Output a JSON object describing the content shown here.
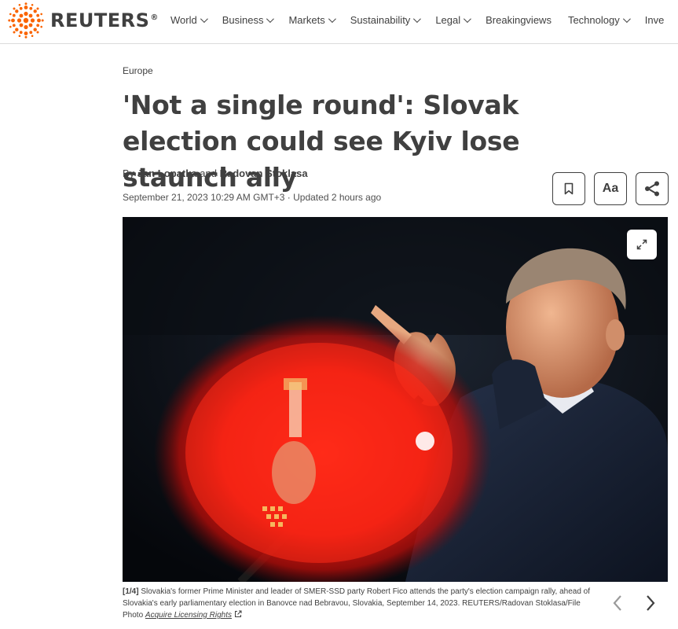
{
  "brand": {
    "name": "REUTERS",
    "reg_mark": "®",
    "accent": "#fa6400"
  },
  "nav": {
    "items": [
      {
        "label": "World",
        "dropdown": true
      },
      {
        "label": "Business",
        "dropdown": true
      },
      {
        "label": "Markets",
        "dropdown": true
      },
      {
        "label": "Sustainability",
        "dropdown": true
      },
      {
        "label": "Legal",
        "dropdown": true
      },
      {
        "label": "Breakingviews",
        "dropdown": false
      },
      {
        "label": "Technology",
        "dropdown": true
      },
      {
        "label": "Inve",
        "dropdown": false
      }
    ]
  },
  "article": {
    "kicker": "Europe",
    "headline": "'Not a single round': Slovak election could see Kyiv lose staunch ally",
    "byline": {
      "prefix": "By ",
      "author1": "Jan Lopatka",
      "conj": " and ",
      "author2": "Radovan Stoklasa"
    },
    "dateline": "September 21, 2023 10:29 AM GMT+3 · Updated 2 hours ago",
    "tools": {
      "bookmark_icon": "bookmark-icon",
      "text_size_label": "Aa",
      "share_icon": "share-icon"
    }
  },
  "photo": {
    "expand_icon": "expand-icon",
    "caption": {
      "counter": "[1/4]",
      "text": " Slovakia's former Prime Minister and leader of SMER-SSD party Robert Fico attends the party's election campaign rally, ahead of Slovakia's early parliamentary election in Banovce nad Bebravou, Slovakia, September 14, 2023. REUTERS/Radovan Stoklasa/File Photo ",
      "license_link": "Acquire Licensing Rights"
    },
    "prev_icon": "chevron-left-icon",
    "next_icon": "chevron-right-icon"
  }
}
